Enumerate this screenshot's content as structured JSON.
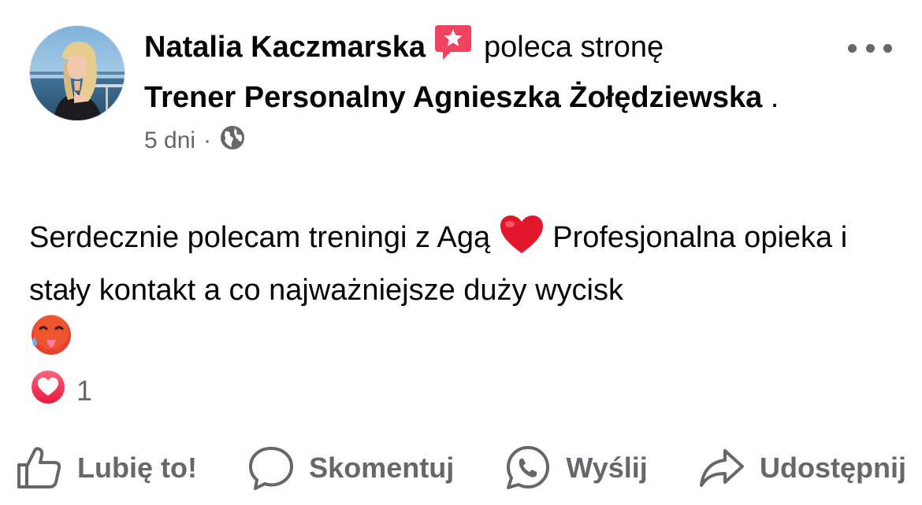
{
  "post": {
    "author": "Natalia Kaczmarska",
    "action_text": "poleca stronę",
    "page_name": "Trener Personalny Agnieszka Żołędziewska",
    "page_suffix": " .",
    "time": "5 dni",
    "time_separator": "·",
    "privacy_icon": "globe-icon",
    "recommend_icon": "recommendation-star-icon",
    "body_part1": "Serdecznie polecam treningi z Agą ",
    "body_part2": " Profesjonalna opieka i stały kontakt a co najważniejsze duży wycisk",
    "body_emoji_1": "red-heart-emoji",
    "body_emoji_2": "hot-face-emoji"
  },
  "reactions": {
    "icon": "love-reaction-icon",
    "count": "1"
  },
  "actions": {
    "like": "Lubię to!",
    "comment": "Skomentuj",
    "send": "Wyślij",
    "share": "Udostępnij"
  },
  "colors": {
    "text": "#050505",
    "secondary": "#65676b",
    "love": "#f33e58",
    "badge": "#f3425f"
  }
}
